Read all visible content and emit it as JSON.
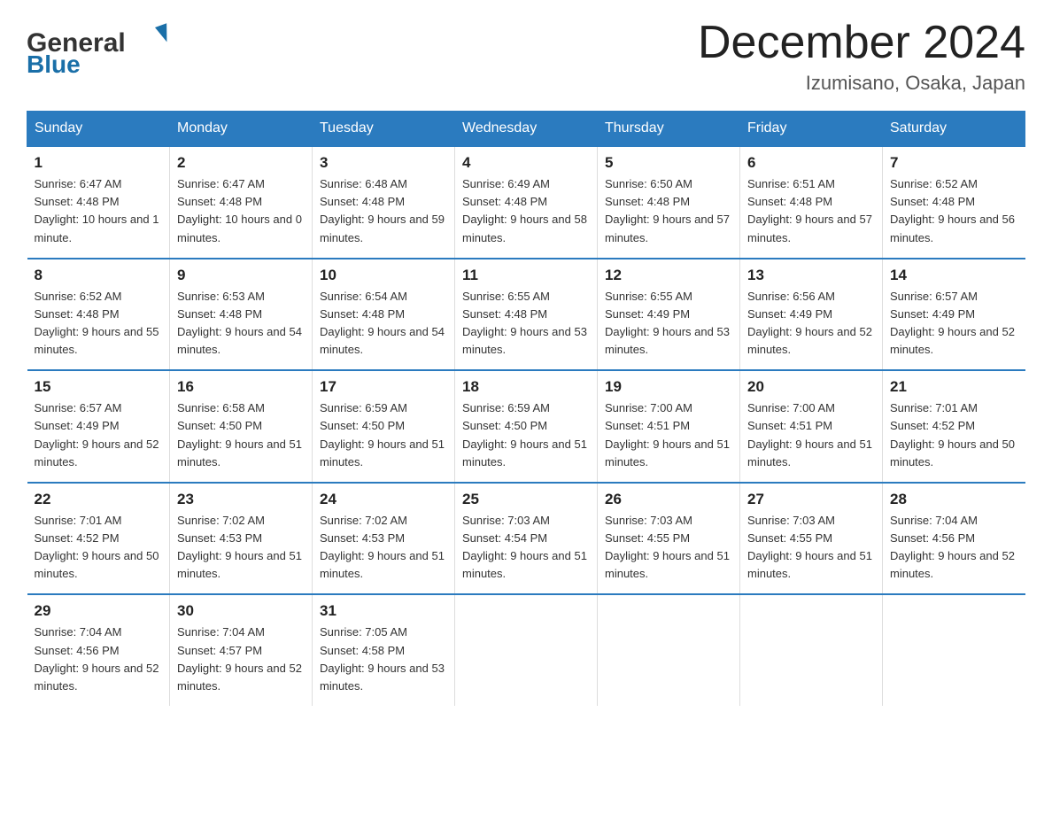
{
  "header": {
    "logo_general": "General",
    "logo_blue": "Blue",
    "month_title": "December 2024",
    "location": "Izumisano, Osaka, Japan"
  },
  "days_of_week": [
    "Sunday",
    "Monday",
    "Tuesday",
    "Wednesday",
    "Thursday",
    "Friday",
    "Saturday"
  ],
  "weeks": [
    [
      {
        "day": "1",
        "sunrise": "6:47 AM",
        "sunset": "4:48 PM",
        "daylight": "10 hours and 1 minute."
      },
      {
        "day": "2",
        "sunrise": "6:47 AM",
        "sunset": "4:48 PM",
        "daylight": "10 hours and 0 minutes."
      },
      {
        "day": "3",
        "sunrise": "6:48 AM",
        "sunset": "4:48 PM",
        "daylight": "9 hours and 59 minutes."
      },
      {
        "day": "4",
        "sunrise": "6:49 AM",
        "sunset": "4:48 PM",
        "daylight": "9 hours and 58 minutes."
      },
      {
        "day": "5",
        "sunrise": "6:50 AM",
        "sunset": "4:48 PM",
        "daylight": "9 hours and 57 minutes."
      },
      {
        "day": "6",
        "sunrise": "6:51 AM",
        "sunset": "4:48 PM",
        "daylight": "9 hours and 57 minutes."
      },
      {
        "day": "7",
        "sunrise": "6:52 AM",
        "sunset": "4:48 PM",
        "daylight": "9 hours and 56 minutes."
      }
    ],
    [
      {
        "day": "8",
        "sunrise": "6:52 AM",
        "sunset": "4:48 PM",
        "daylight": "9 hours and 55 minutes."
      },
      {
        "day": "9",
        "sunrise": "6:53 AM",
        "sunset": "4:48 PM",
        "daylight": "9 hours and 54 minutes."
      },
      {
        "day": "10",
        "sunrise": "6:54 AM",
        "sunset": "4:48 PM",
        "daylight": "9 hours and 54 minutes."
      },
      {
        "day": "11",
        "sunrise": "6:55 AM",
        "sunset": "4:48 PM",
        "daylight": "9 hours and 53 minutes."
      },
      {
        "day": "12",
        "sunrise": "6:55 AM",
        "sunset": "4:49 PM",
        "daylight": "9 hours and 53 minutes."
      },
      {
        "day": "13",
        "sunrise": "6:56 AM",
        "sunset": "4:49 PM",
        "daylight": "9 hours and 52 minutes."
      },
      {
        "day": "14",
        "sunrise": "6:57 AM",
        "sunset": "4:49 PM",
        "daylight": "9 hours and 52 minutes."
      }
    ],
    [
      {
        "day": "15",
        "sunrise": "6:57 AM",
        "sunset": "4:49 PM",
        "daylight": "9 hours and 52 minutes."
      },
      {
        "day": "16",
        "sunrise": "6:58 AM",
        "sunset": "4:50 PM",
        "daylight": "9 hours and 51 minutes."
      },
      {
        "day": "17",
        "sunrise": "6:59 AM",
        "sunset": "4:50 PM",
        "daylight": "9 hours and 51 minutes."
      },
      {
        "day": "18",
        "sunrise": "6:59 AM",
        "sunset": "4:50 PM",
        "daylight": "9 hours and 51 minutes."
      },
      {
        "day": "19",
        "sunrise": "7:00 AM",
        "sunset": "4:51 PM",
        "daylight": "9 hours and 51 minutes."
      },
      {
        "day": "20",
        "sunrise": "7:00 AM",
        "sunset": "4:51 PM",
        "daylight": "9 hours and 51 minutes."
      },
      {
        "day": "21",
        "sunrise": "7:01 AM",
        "sunset": "4:52 PM",
        "daylight": "9 hours and 50 minutes."
      }
    ],
    [
      {
        "day": "22",
        "sunrise": "7:01 AM",
        "sunset": "4:52 PM",
        "daylight": "9 hours and 50 minutes."
      },
      {
        "day": "23",
        "sunrise": "7:02 AM",
        "sunset": "4:53 PM",
        "daylight": "9 hours and 51 minutes."
      },
      {
        "day": "24",
        "sunrise": "7:02 AM",
        "sunset": "4:53 PM",
        "daylight": "9 hours and 51 minutes."
      },
      {
        "day": "25",
        "sunrise": "7:03 AM",
        "sunset": "4:54 PM",
        "daylight": "9 hours and 51 minutes."
      },
      {
        "day": "26",
        "sunrise": "7:03 AM",
        "sunset": "4:55 PM",
        "daylight": "9 hours and 51 minutes."
      },
      {
        "day": "27",
        "sunrise": "7:03 AM",
        "sunset": "4:55 PM",
        "daylight": "9 hours and 51 minutes."
      },
      {
        "day": "28",
        "sunrise": "7:04 AM",
        "sunset": "4:56 PM",
        "daylight": "9 hours and 52 minutes."
      }
    ],
    [
      {
        "day": "29",
        "sunrise": "7:04 AM",
        "sunset": "4:56 PM",
        "daylight": "9 hours and 52 minutes."
      },
      {
        "day": "30",
        "sunrise": "7:04 AM",
        "sunset": "4:57 PM",
        "daylight": "9 hours and 52 minutes."
      },
      {
        "day": "31",
        "sunrise": "7:05 AM",
        "sunset": "4:58 PM",
        "daylight": "9 hours and 53 minutes."
      },
      null,
      null,
      null,
      null
    ]
  ]
}
